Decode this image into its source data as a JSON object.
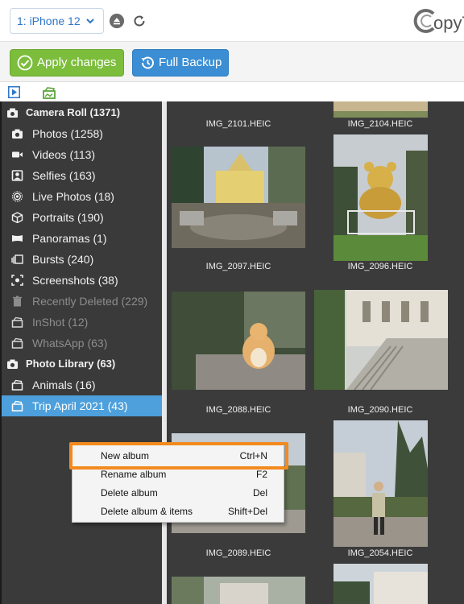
{
  "topbar": {
    "device_label": "1: iPhone 12",
    "logo_text": "opyT"
  },
  "actions": {
    "apply_label": "Apply changes",
    "backup_label": "Full Backup"
  },
  "sidebar": {
    "items": [
      {
        "label": "Camera Roll (1371)",
        "icon": "camera-roll-icon",
        "kind": "header"
      },
      {
        "label": "Photos (1258)",
        "icon": "camera-icon"
      },
      {
        "label": "Videos (113)",
        "icon": "video-icon"
      },
      {
        "label": "Selfies (163)",
        "icon": "selfie-icon"
      },
      {
        "label": "Live Photos (18)",
        "icon": "live-photo-icon"
      },
      {
        "label": "Portraits (190)",
        "icon": "cube-icon"
      },
      {
        "label": "Panoramas (1)",
        "icon": "panorama-icon"
      },
      {
        "label": "Bursts (240)",
        "icon": "burst-icon"
      },
      {
        "label": "Screenshots (38)",
        "icon": "screenshot-icon"
      },
      {
        "label": "Recently Deleted (229)",
        "icon": "trash-icon",
        "kind": "dim"
      },
      {
        "label": "InShot (12)",
        "icon": "album-icon",
        "kind": "dim"
      },
      {
        "label": "WhatsApp (63)",
        "icon": "album-icon",
        "kind": "dim"
      },
      {
        "label": "Photo Library (63)",
        "icon": "camera-icon",
        "kind": "header"
      },
      {
        "label": "Animals (16)",
        "icon": "album-icon"
      },
      {
        "label": "Trip April 2021 (43)",
        "icon": "album-icon",
        "kind": "selected"
      }
    ]
  },
  "gallery": {
    "captions": [
      "IMG_2101.HEIC",
      "IMG_2104.HEIC",
      "IMG_2097.HEIC",
      "IMG_2096.HEIC",
      "IMG_2088.HEIC",
      "IMG_2090.HEIC",
      "IMG_2089.HEIC",
      "IMG_2054.HEIC"
    ]
  },
  "context_menu": {
    "items": [
      {
        "label": "New album",
        "shortcut": "Ctrl+N"
      },
      {
        "label": "Rename album",
        "shortcut": "F2"
      },
      {
        "label": "Delete album",
        "shortcut": "Del"
      },
      {
        "label": "Delete album & items",
        "shortcut": "Shift+Del"
      }
    ]
  },
  "colors": {
    "accent_blue": "#3b8ed3",
    "apply_green": "#7cbd3c",
    "selection": "#4da0dc",
    "highlight_orange": "#f28a1e",
    "sidebar_bg": "#3a3a3a"
  }
}
